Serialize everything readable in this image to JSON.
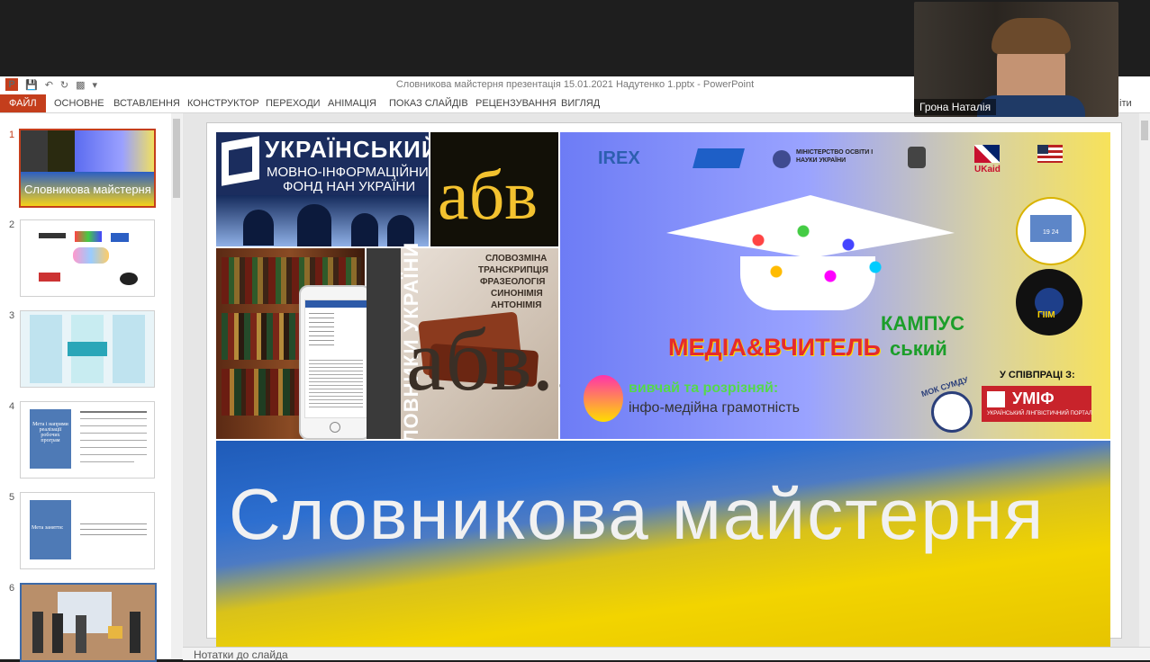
{
  "window": {
    "title": "Словникова майстерня презентація 15.01.2021 Надутенко 1.pptx - PowerPoint"
  },
  "ribbon": {
    "tabs": [
      "ФАЙЛ",
      "ОСНОВНЕ",
      "ВСТАВЛЕННЯ",
      "КОНСТРУКТОР",
      "ПЕРЕХОДИ",
      "АНІМАЦІЯ",
      "ПОКАЗ СЛАЙДІВ",
      "РЕЦЕНЗУВАННЯ",
      "ВИГЛЯД"
    ],
    "right_fragment": "іти"
  },
  "thumbnails": {
    "numbers": [
      "1",
      "2",
      "3",
      "4",
      "5",
      "6"
    ],
    "t1_caption": "Словникова майстерня",
    "t4_box": "Мета і напрями реалізації робочих програм",
    "t5_box": "Мета заняття:"
  },
  "slide": {
    "logo1_line1": "УКРАЇНСЬКИЙ",
    "logo1_line2": "МОВНО-ІНФОРМАЦІЙНИЙ",
    "logo1_line3": "ФОНД НАН УКРАЇНИ",
    "abv_big": "абв",
    "dict_side": "СЛОВНИКИ УКРАЇНИ",
    "dict_list": [
      "СЛОВОЗМІНА",
      "ТРАНСКРИПЦІЯ",
      "ФРАЗЕОЛОГІЯ",
      "СИНОНІМІЯ",
      "АНТОНІМІЯ"
    ],
    "abv_book": "абв...",
    "partners": [
      "IREX",
      "МІНІСТЕРСТВО ОСВІТИ І НАУКИ УКРАЇНИ",
      "UKaid"
    ],
    "campus_1": "КАМПУС",
    "campus_2": "МЕДІА&ВЧИТЕЛЬ",
    "campus_3": "ський",
    "learn_1": "вивчай та розрізняй:",
    "learn_2": "інфо-медійна грамотність",
    "coop": "У СПІВПРАЦІ З:",
    "mok": "МОК СУМДУ",
    "umif": "УМІФ",
    "umif_sub": "УКРАЇНСЬКИЙ ЛІНГВІСТИЧНИЙ ПОРТАЛ",
    "giim": "ГІІМ",
    "seal_year": "19 24",
    "main_title": "Словникова майстерня"
  },
  "notes": {
    "label": "Нотатки до слайда"
  },
  "webcam": {
    "name": "Грона Наталія"
  },
  "colors": {
    "accent": "#c43e1c",
    "ukraine_blue": "#1f5bb8",
    "ukraine_yellow": "#f2d400"
  }
}
